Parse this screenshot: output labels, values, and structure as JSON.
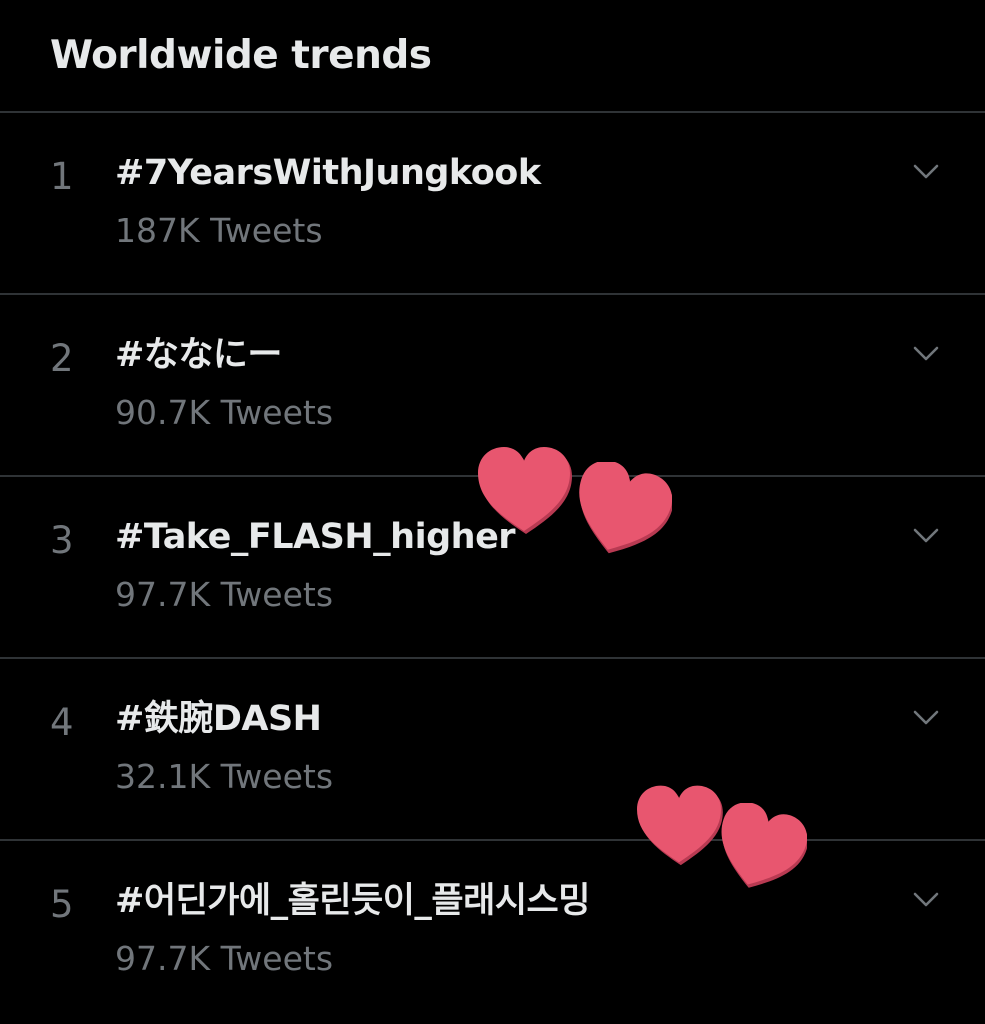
{
  "header": {
    "title": "Worldwide trends"
  },
  "trends": [
    {
      "rank": "1",
      "tag": "#7YearsWithJungkook",
      "count": "187K Tweets"
    },
    {
      "rank": "2",
      "tag": "#ななにー",
      "count": "90.7K Tweets"
    },
    {
      "rank": "3",
      "tag": "#Take_FLASH_higher",
      "count": "97.7K Tweets"
    },
    {
      "rank": "4",
      "tag": "#鉄腕DASH",
      "count": "32.1K Tweets"
    },
    {
      "rank": "5",
      "tag": "#어딘가에_홀린듯이_플래시스밍",
      "count": "97.7K Tweets"
    }
  ],
  "icons": {
    "chevron": "chevron-down-icon",
    "decoration": "heart-sticker"
  },
  "colors": {
    "background": "#000000",
    "primary_text": "#e7e9ea",
    "secondary_text": "#71767b",
    "divider": "#2f3336",
    "heart": "#e8566f"
  }
}
